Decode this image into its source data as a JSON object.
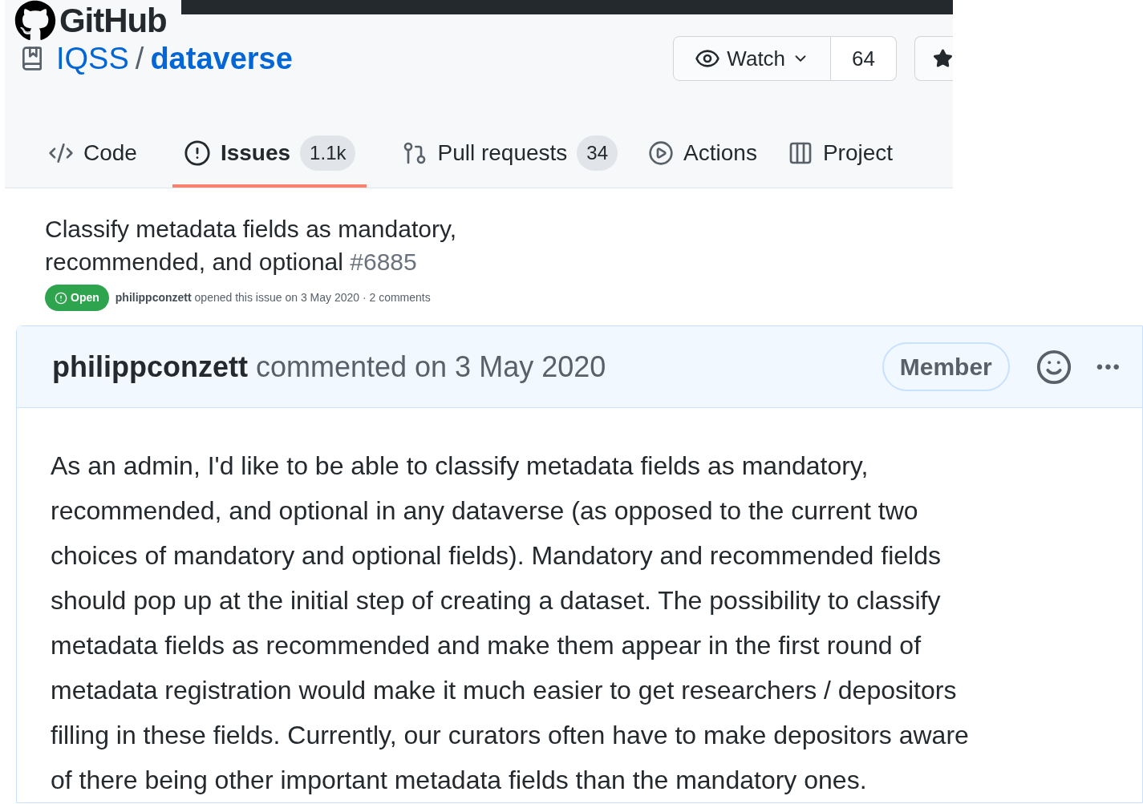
{
  "header": {
    "logo_text": "GitHub",
    "owner": "IQSS",
    "separator": "/",
    "repo": "dataverse",
    "watch": {
      "label": "Watch",
      "count": "64"
    }
  },
  "tabs": [
    {
      "kind": "code",
      "label": "Code",
      "selected": false
    },
    {
      "kind": "issues",
      "label": "Issues",
      "count": "1.1k",
      "selected": true
    },
    {
      "kind": "pulls",
      "label": "Pull requests",
      "count": "34",
      "selected": false
    },
    {
      "kind": "actions",
      "label": "Actions",
      "selected": false
    },
    {
      "kind": "projects",
      "label": "Project",
      "selected": false
    }
  ],
  "issue": {
    "title": "Classify metadata fields as mandatory, recommended, and optional",
    "number": "#6885",
    "state": {
      "label": "Open",
      "open": true
    },
    "author": "philippconzett",
    "meta": "opened this issue on 3 May 2020 · 2 comments"
  },
  "comment": {
    "author": "philippconzett",
    "action": "commented on 3 May 2020",
    "role": "Member",
    "more": "•••",
    "body_lines": [
      "As an admin, I'd like to be able to classify metadata fields as mandatory,",
      "recommended, and optional in any dataverse (as opposed to the current two",
      "choices of mandatory and optional fields). Mandatory and recommended fields",
      "should pop up at the initial step of creating a dataset. The possibility to classify",
      "metadata fields as recommended and make them appear in the first round of",
      "metadata registration would make it much easier to get researchers / depositors",
      "filling in these fields. Currently, our curators often have to make depositors aware",
      "of there being other important metadata fields than the mandatory ones."
    ]
  }
}
